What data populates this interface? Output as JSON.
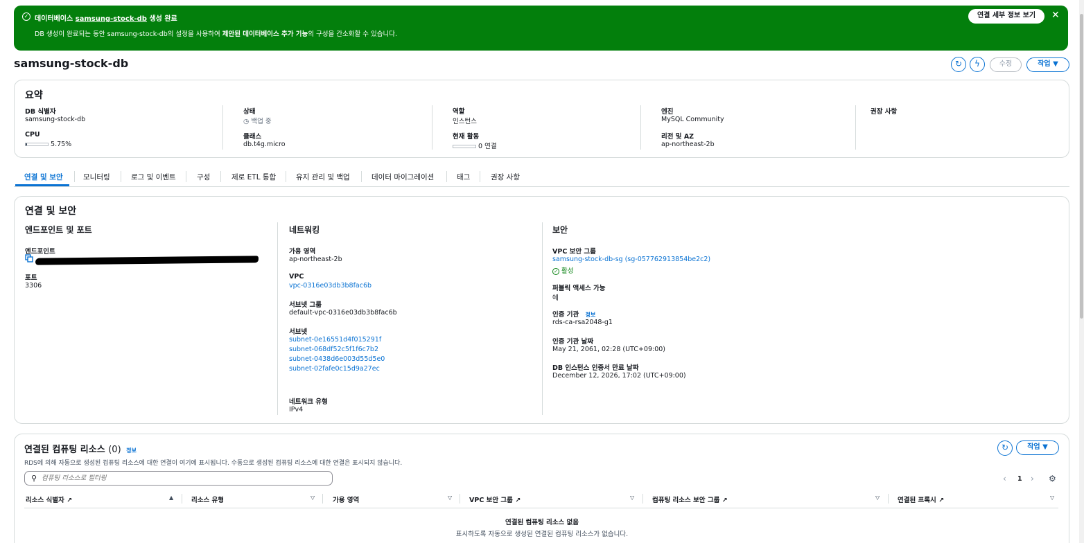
{
  "banner": {
    "title_prefix": "데이터베이스",
    "title_db": "samsung-stock-db",
    "title_suffix": "생성 완료",
    "msg_a": "DB 생성이 완료되는 동안 samsung-stock-db의 설정을 사용하여",
    "msg_b": "제안된 데이터베이스 추가 기능",
    "msg_c": "의 구성을 간소화할 수 있습니다.",
    "button": "연결 세부 정보 보기"
  },
  "page": {
    "title": "samsung-stock-db",
    "edit": "수정",
    "actions": "작업 ▼"
  },
  "summary": {
    "title": "요약",
    "items": [
      {
        "label": "DB 식별자",
        "value": "samsung-stock-db"
      },
      {
        "label": "상태",
        "value": "백업 중"
      },
      {
        "label": "역할",
        "value": "인스턴스"
      },
      {
        "label": "엔진",
        "value": "MySQL Community"
      },
      {
        "label": "권장 사항",
        "value": ""
      },
      {
        "label": "CPU",
        "value": "5.75%",
        "fraction": 0.0575
      },
      {
        "label": "클래스",
        "value": "db.t4g.micro"
      },
      {
        "label": "현재 활동",
        "value": "0 연결",
        "fraction": 0
      },
      {
        "label": "리전 및 AZ",
        "value": "ap-northeast-2b"
      }
    ]
  },
  "tabs": [
    "연결 및 보안",
    "모니터링",
    "로그 및 이벤트",
    "구성",
    "제로 ETL 통합",
    "유지 관리 및 백업",
    "데이터 마이그레이션",
    "태그",
    "권장 사항"
  ],
  "conn": {
    "title": "연결 및 보안",
    "col1": {
      "title": "엔드포인트 및 포트",
      "endpoint_label": "엔드포인트",
      "port_label": "포트",
      "port": "3306"
    },
    "col2": {
      "title": "네트워킹",
      "az_label": "가용 영역",
      "az": "ap-northeast-2b",
      "vpc_label": "VPC",
      "vpc": "vpc-0316e03db3b8fac6b",
      "subnet_group_label": "서브넷 그룹",
      "subnet_group": "default-vpc-0316e03db3b8fac6b",
      "subnets_label": "서브넷",
      "subnets": [
        "subnet-0e16551d4f015291f",
        "subnet-068df52c5f1f6c7b2",
        "subnet-0438d6e003d55d5e0",
        "subnet-02fafe0c15d9a27ec"
      ],
      "net_type_label": "네트워크 유형",
      "net_type": "IPv4"
    },
    "col3": {
      "title": "보안",
      "sg_label": "VPC 보안 그룹",
      "sg": "samsung-stock-db-sg (sg-057762913854be2c2)",
      "sg_status": "활성",
      "public_label": "퍼블릭 액세스 가능",
      "public": "예",
      "ca_label": "인증 기관",
      "ca_info": "정보",
      "ca": "rds-ca-rsa2048-g1",
      "ca_date_label": "인증 기관 날짜",
      "ca_date": "May 21, 2061, 02:28 (UTC+09:00)",
      "cert_exp_label": "DB 인스턴스 인증서 만료 날짜",
      "cert_exp": "December 12, 2026, 17:02 (UTC+09:00)"
    }
  },
  "compute": {
    "title": "연결된 컴퓨팅 리소스",
    "count": "(0)",
    "info": "정보",
    "desc": "RDS에 의해 자동으로 생성된 컴퓨팅 리소스에 대한 연결이 여기에 표시됩니다. 수동으로 생성된 컴퓨팅 리소스에 대한 연결은 표시되지 않습니다.",
    "actions": "작업 ▼",
    "search_placeholder": "컴퓨팅 리소스로 필터링",
    "page": "1",
    "columns": [
      "리소스 식별자",
      "리소스 유형",
      "가용 영역",
      "VPC 보안 그룹",
      "컴퓨팅 리소스 보안 그룹",
      "연결된 프록시"
    ],
    "empty_title": "연결된 컴퓨팅 리소스 없음",
    "empty_desc": "표시하도록 자동으로 생성된 연결된 컴퓨팅 리소스가 없습니다."
  }
}
